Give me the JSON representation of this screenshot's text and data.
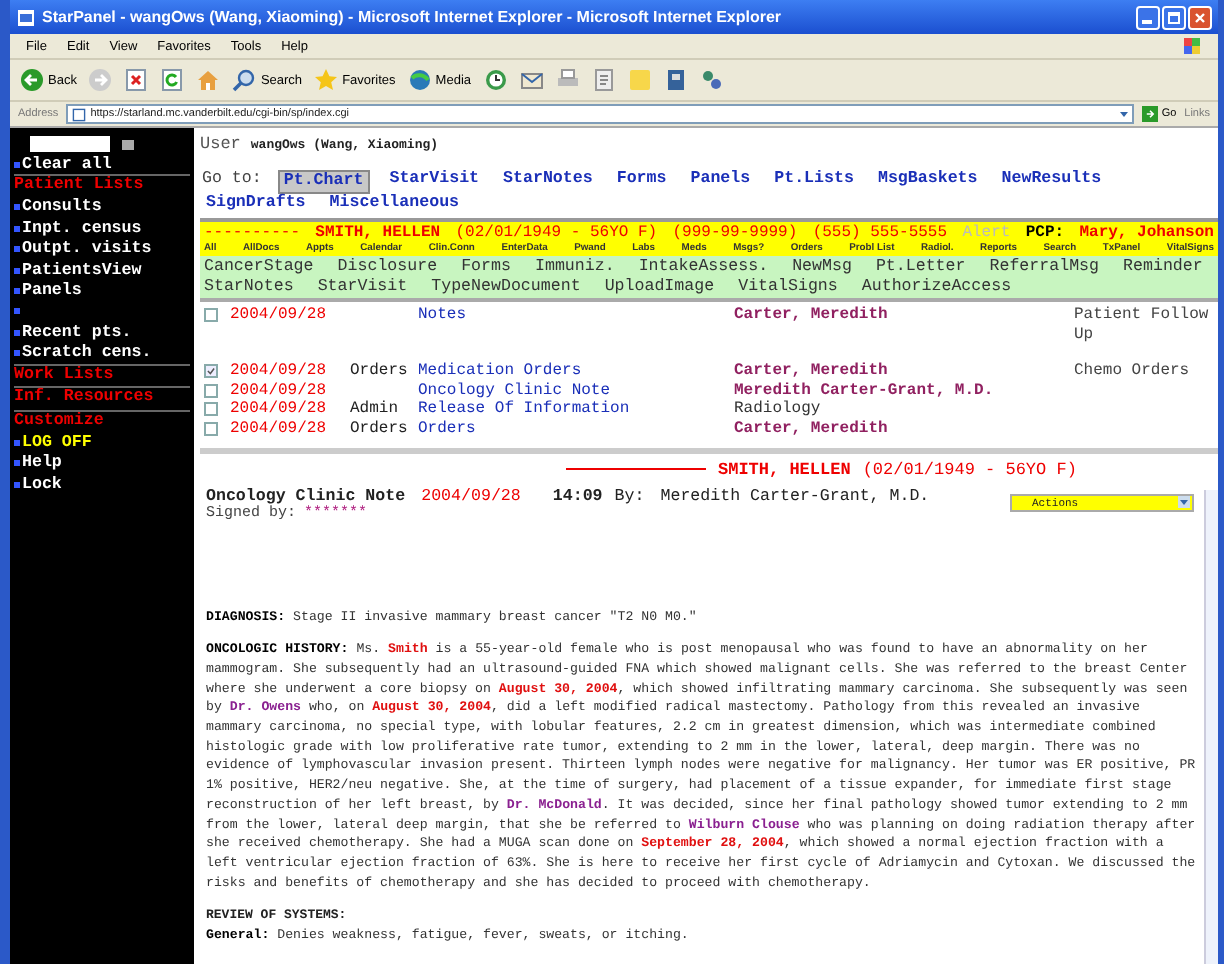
{
  "window": {
    "title": "StarPanel - wangOws (Wang, Xiaoming) - Microsoft Internet Explorer - Microsoft Internet Explorer"
  },
  "menu": [
    "File",
    "Edit",
    "View",
    "Favorites",
    "Tools",
    "Help"
  ],
  "toolbar": {
    "back": "Back",
    "search": "Search",
    "favorites": "Favorites",
    "media": "Media"
  },
  "address": {
    "label": "Address",
    "url": "https://starland.mc.vanderbilt.edu/cgi-bin/sp/index.cgi",
    "go": "Go",
    "links": "Links"
  },
  "sidebar": {
    "items": [
      {
        "kind": "link",
        "label": "Clear all"
      },
      {
        "kind": "header",
        "label": "Patient Lists"
      },
      {
        "kind": "link",
        "label": "Consults"
      },
      {
        "kind": "link",
        "label": "Inpt. census"
      },
      {
        "kind": "link",
        "label": "Outpt. visits"
      },
      {
        "kind": "link",
        "label": "PatientsView"
      },
      {
        "kind": "link",
        "label": "Panels"
      },
      {
        "kind": "blank"
      },
      {
        "kind": "link",
        "label": "Recent pts."
      },
      {
        "kind": "link",
        "label": "Scratch cens."
      },
      {
        "kind": "header",
        "label": "Work Lists"
      },
      {
        "kind": "header",
        "label": "Inf. Resources"
      },
      {
        "kind": "header",
        "label": "Customize"
      },
      {
        "kind": "alert",
        "label": "LOG OFF"
      },
      {
        "kind": "link",
        "label": "Help"
      },
      {
        "kind": "link",
        "label": "Lock"
      }
    ]
  },
  "user": {
    "label": "User",
    "value": "wangOws (Wang, Xiaoming)"
  },
  "goto": {
    "label": "Go to:",
    "tabs": [
      {
        "label": "Pt.Chart",
        "selected": true
      },
      {
        "label": "StarVisit",
        "selected": false
      },
      {
        "label": "StarNotes",
        "selected": false
      },
      {
        "label": "Forms",
        "selected": false
      },
      {
        "label": "Panels",
        "selected": false
      },
      {
        "label": "Pt.Lists",
        "selected": false
      },
      {
        "label": "MsgBaskets",
        "selected": false
      },
      {
        "label": "NewResults",
        "selected": false
      },
      {
        "label": "SignDrafts",
        "selected": false
      },
      {
        "label": "Miscellaneous",
        "selected": false
      }
    ]
  },
  "banner": {
    "dashes": "----------",
    "name": "SMITH, HELLEN",
    "dob": "(02/01/1949 - 56YO F)",
    "ssn": "(999-99-9999)",
    "phone": "(555) 555-5555",
    "alert": "Alert",
    "pcp_label": "PCP:",
    "pcp": "Mary, Johanson",
    "links": [
      "All",
      "AllDocs",
      "Appts",
      "Calendar",
      "Clin.Conn",
      "EnterData",
      "Pwand",
      "Labs",
      "Meds",
      "Msgs?",
      "Orders",
      "Probl List",
      "Radiol.",
      "Reports",
      "Search",
      "TxPanel",
      "VitalSigns"
    ]
  },
  "actions": [
    [
      "CancerStage",
      "Disclosure",
      "Forms",
      "Immuniz.",
      "IntakeAssess.",
      "NewMsg",
      "Pt.Letter",
      "ReferralMsg",
      "Reminder"
    ],
    [
      "StarNotes",
      "StarVisit",
      "TypeNewDocument",
      "UploadImage",
      "VitalSigns",
      "AuthorizeAccess"
    ]
  ],
  "documents": [
    {
      "checked": false,
      "date": "2004/09/28",
      "title": "Notes",
      "author": "Carter, Meredith",
      "author_link": true,
      "note": "Patient Follow Up"
    },
    {
      "checked": true,
      "date": "2004/09/28",
      "type": "Orders",
      "title": "Medication Orders",
      "author": "Carter, Meredith",
      "author_link": true,
      "note": "Chemo Orders"
    },
    {
      "checked": false,
      "date": "2004/09/28",
      "title": "Oncology Clinic Note",
      "author": "Meredith Carter-Grant, M.D.",
      "author_link": true
    },
    {
      "checked": false,
      "date": "2004/09/28",
      "type": "Admin",
      "title": "Release Of Information",
      "author": "Radiology",
      "author_link": false
    },
    {
      "checked": false,
      "date": "2004/09/28",
      "type": "Orders",
      "title": "Orders",
      "author": "Carter, Meredith",
      "author_link": true
    }
  ],
  "note": {
    "header_name": "SMITH, HELLEN",
    "header_dob": "(02/01/1949 - 56YO F)",
    "title": "Oncology Clinic Note",
    "date": "2004/09/28",
    "time": "14:09",
    "by_label": "By:",
    "author": "Meredith Carter-Grant, M.D.",
    "actions": "Actions",
    "signed_label": "Signed by:",
    "signed": "*******",
    "sections": [
      {
        "kind": "paragraph",
        "segments": [
          {
            "kind": "label",
            "text": "DIAGNOSIS:"
          },
          {
            "kind": "text",
            "text": "  Stage II invasive mammary breast cancer \"T2 N0 M0.\""
          }
        ]
      },
      {
        "kind": "paragraph",
        "segments": [
          {
            "kind": "label",
            "text": "ONCOLOGIC HISTORY:"
          },
          {
            "kind": "text",
            "text": "  Ms. "
          },
          {
            "kind": "date",
            "text": "Smith"
          },
          {
            "kind": "text",
            "text": " is a 55-year-old female who is post menopausal who was found to have an abnormality on her mammogram. She subsequently had an ultrasound-guided FNA which showed malignant cells. She was referred to the breast Center where she underwent a core biopsy on "
          },
          {
            "kind": "date",
            "text": "August 30, 2004"
          },
          {
            "kind": "text",
            "text": ", which showed infiltrating mammary carcinoma. She subsequently was seen by "
          },
          {
            "kind": "person",
            "text": "Dr. Owens"
          },
          {
            "kind": "text",
            "text": " who, on "
          },
          {
            "kind": "date",
            "text": "August 30, 2004"
          },
          {
            "kind": "text",
            "text": ", did a left modified radical mastectomy. Pathology from this revealed an invasive mammary carcinoma, no special type, with lobular features, 2.2 cm in greatest dimension, which was intermediate combined histologic grade with low proliferative rate tumor, extending to 2 mm in the lower, lateral, deep margin. There was no evidence of lymphovascular invasion present. Thirteen lymph nodes were negative for malignancy. Her tumor was ER positive, PR 1% positive, HER2/neu negative. She, at the time of surgery, had placement of a tissue expander, for immediate first stage reconstruction of her left breast, by "
          },
          {
            "kind": "person",
            "text": "Dr. McDonald"
          },
          {
            "kind": "text",
            "text": ". It was decided, since her final pathology showed tumor extending to 2 mm from the lower, lateral deep margin, that she be referred to "
          },
          {
            "kind": "person",
            "text": "Wilburn Clouse"
          },
          {
            "kind": "text",
            "text": " who was planning on doing radiation therapy after she received chemotherapy. She had a MUGA scan done on "
          },
          {
            "kind": "date",
            "text": "September 28, 2004"
          },
          {
            "kind": "text",
            "text": ", which showed a normal ejection fraction with a left ventricular ejection fraction of 63%. She is here to receive her first cycle of Adriamycin and Cytoxan. We discussed the risks and benefits of chemotherapy and she has decided to proceed with chemotherapy."
          }
        ]
      },
      {
        "kind": "heading",
        "text": "REVIEW OF SYSTEMS:"
      },
      {
        "kind": "paragraph",
        "segments": [
          {
            "kind": "label",
            "text": "General:"
          },
          {
            "kind": "text",
            "text": "  Denies weakness, fatigue, fever, sweats, or itching."
          }
        ]
      }
    ]
  }
}
